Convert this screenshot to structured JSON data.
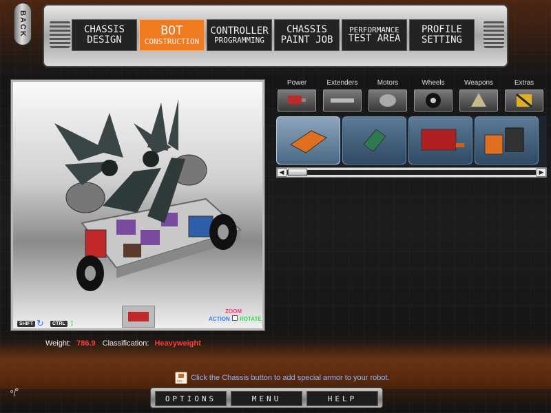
{
  "back_label": "BACK",
  "nav": {
    "tabs": [
      {
        "line1": "CHASSIS",
        "line2": "DESIGN",
        "active": false
      },
      {
        "line1": "BOT",
        "line2": "CONSTRUCTION",
        "active": true
      },
      {
        "line1": "CONTROLLER",
        "line2": "PROGRAMMING",
        "active": false
      },
      {
        "line1": "CHASSIS",
        "line2": "PAINT JOB",
        "active": false
      },
      {
        "line1": "PERFORMANCE",
        "line2": "TEST AREA",
        "active": false
      },
      {
        "line1": "PROFILE",
        "line2": "SETTING",
        "active": false
      }
    ]
  },
  "viewport": {
    "shift_label": "SHIFT",
    "ctrl_label": "CTRL",
    "zoom_label": "ZOOM",
    "action_label": "ACTION",
    "rotate_label": "ROTATE"
  },
  "parts": {
    "categories": [
      "Power",
      "Extenders",
      "Motors",
      "Wheels",
      "Weapons",
      "Extras"
    ],
    "items": [
      {
        "icon": "battery-pack-orange-icon",
        "selected": true
      },
      {
        "icon": "circuit-board-icon",
        "selected": false
      },
      {
        "icon": "red-battery-icon",
        "selected": false
      },
      {
        "icon": "battery-cells-icon",
        "selected": false
      }
    ]
  },
  "stats": {
    "weight_label": "Weight:",
    "weight_value": "786.9",
    "classification_label": "Classification:",
    "classification_value": "Heavyweight"
  },
  "tip": {
    "icon_label": "tips",
    "text": "Click the Chassis button to add special armor to your robot."
  },
  "bottom_menu": {
    "options": "OPTIONS",
    "menu": "MENU",
    "help": "HELP"
  },
  "colors": {
    "accent": "#f07a20",
    "value_red": "#ff3b3b",
    "tip_blue": "#8fb3ff",
    "zoom_pink": "#ff2f86",
    "rotate_green": "#2fd54a",
    "action_blue": "#2f7bff"
  }
}
